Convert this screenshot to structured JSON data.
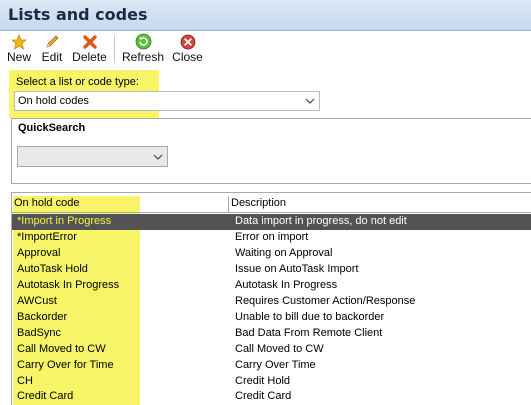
{
  "window": {
    "title": "Lists and codes"
  },
  "toolbar": {
    "buttons": [
      {
        "label": "New",
        "icon": "star-icon"
      },
      {
        "label": "Edit",
        "icon": "pencil-icon"
      },
      {
        "label": "Delete",
        "icon": "delete-x-icon"
      },
      {
        "label": "Refresh",
        "icon": "refresh-icon"
      },
      {
        "label": "Close",
        "icon": "close-circle-icon"
      }
    ]
  },
  "type_selector": {
    "label": "Select a list or code type:",
    "value": "On hold codes"
  },
  "quicksearch": {
    "label": "QuickSearch",
    "value": ""
  },
  "grid": {
    "columns": [
      "On hold code",
      "Description"
    ],
    "rows": [
      {
        "code": "*Import in Progress",
        "description": "Data import in progress, do not edit",
        "selected": true
      },
      {
        "code": "*ImportError",
        "description": "Error on import"
      },
      {
        "code": "Approval",
        "description": "Waiting on Approval"
      },
      {
        "code": "AutoTask Hold",
        "description": "Issue on AutoTask Import"
      },
      {
        "code": "Autotask In Progress",
        "description": "Autotask In Progress"
      },
      {
        "code": "AWCust",
        "description": "Requires Customer Action/Response"
      },
      {
        "code": "Backorder",
        "description": "Unable to bill due to backorder"
      },
      {
        "code": "BadSync",
        "description": "Bad Data From Remote Client"
      },
      {
        "code": "Call Moved to CW",
        "description": "Call Moved to CW"
      },
      {
        "code": "Carry Over for Time",
        "description": "Carry Over Time"
      },
      {
        "code": "CH",
        "description": "Credit Hold"
      },
      {
        "code": "Credit Card",
        "description": "Credit Card"
      }
    ]
  },
  "colors": {
    "highlight": "#f6f24c",
    "selected_row": "#535353",
    "title_bg": "#c7d8ee"
  }
}
